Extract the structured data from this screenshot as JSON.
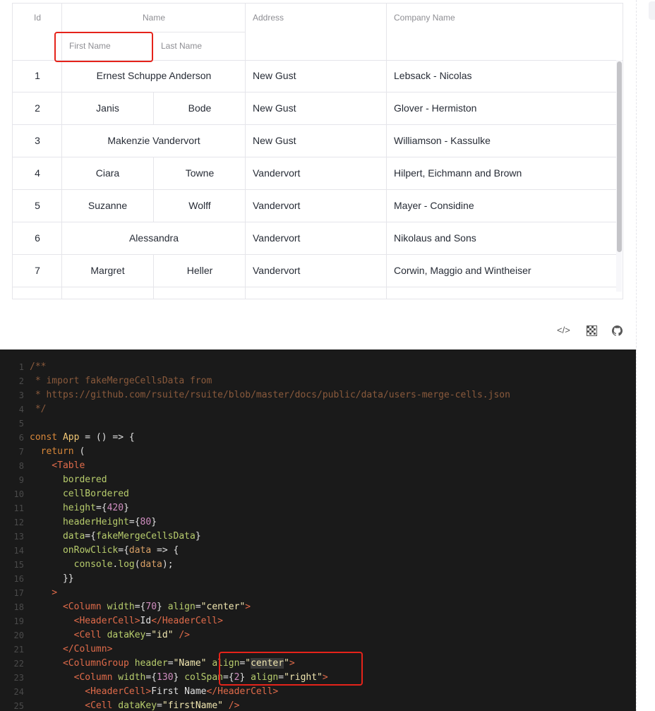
{
  "table": {
    "headers": {
      "id": "Id",
      "name_group": "Name",
      "first_name": "First Name",
      "last_name": "Last Name",
      "address": "Address",
      "company": "Company Name"
    },
    "rows": [
      {
        "id": "1",
        "merged": "Ernest Schuppe Anderson",
        "address": "New Gust",
        "company": "Lebsack - Nicolas"
      },
      {
        "id": "2",
        "first": "Janis",
        "last": "Bode",
        "address": "New Gust",
        "company": "Glover - Hermiston"
      },
      {
        "id": "3",
        "merged": "Makenzie Vandervort",
        "address": "New Gust",
        "company": "Williamson - Kassulke"
      },
      {
        "id": "4",
        "first": "Ciara",
        "last": "Towne",
        "address": "Vandervort",
        "company": "Hilpert, Eichmann and Brown"
      },
      {
        "id": "5",
        "first": "Suzanne",
        "last": "Wolff",
        "address": "Vandervort",
        "company": "Mayer - Considine"
      },
      {
        "id": "6",
        "merged": "Alessandra",
        "address": "Vandervort",
        "company": "Nikolaus and Sons"
      },
      {
        "id": "7",
        "first": "Margret",
        "last": "Heller",
        "address": "Vandervort",
        "company": "Corwin, Maggio and Wintheiser"
      }
    ]
  },
  "toolbar": {
    "code_icon": "</>",
    "sandbox_icon": "grid-icon",
    "github_icon": "github-icon"
  },
  "code": {
    "line_numbers": [
      "1",
      "2",
      "3",
      "4",
      "5",
      "6",
      "7",
      "8",
      "9",
      "10",
      "11",
      "12",
      "13",
      "14",
      "15",
      "16",
      "17",
      "18",
      "19",
      "20",
      "21",
      "22",
      "23",
      "24",
      "25"
    ]
  }
}
